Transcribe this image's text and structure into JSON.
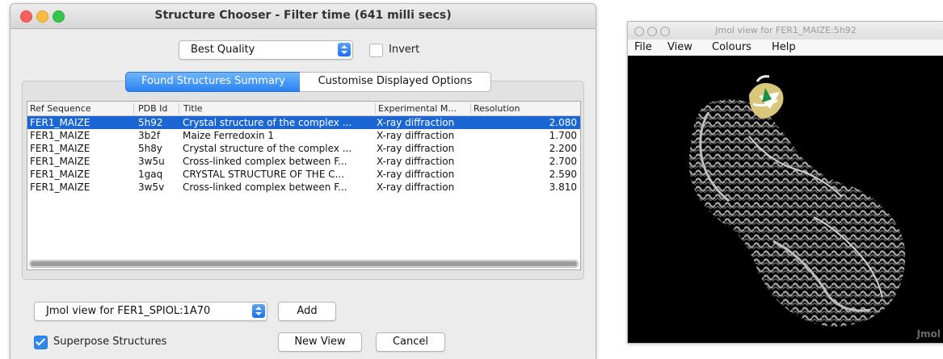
{
  "chooser_window": {
    "title": "Structure Chooser - Filter time (641 milli secs)",
    "filter_select": "Best Quality",
    "invert_label": "Invert",
    "invert_checked": false,
    "tabs": [
      {
        "label": "Found Structures Summary",
        "active": true
      },
      {
        "label": "Customise Displayed Options",
        "active": false
      }
    ],
    "table": {
      "columns": [
        "Ref Sequence",
        "PDB Id",
        "Title",
        "Experimental M...",
        "Resolution"
      ],
      "rows": [
        {
          "ref": "FER1_MAIZE",
          "pdb": "5h92",
          "title": "Crystal structure of the complex ...",
          "exp": "X-ray diffraction",
          "res": "2.080",
          "selected": true
        },
        {
          "ref": "FER1_MAIZE",
          "pdb": "3b2f",
          "title": "Maize Ferredoxin 1",
          "exp": "X-ray diffraction",
          "res": "1.700",
          "selected": false
        },
        {
          "ref": "FER1_MAIZE",
          "pdb": "5h8y",
          "title": "Crystal structure of the complex ...",
          "exp": "X-ray diffraction",
          "res": "2.200",
          "selected": false
        },
        {
          "ref": "FER1_MAIZE",
          "pdb": "3w5u",
          "title": "Cross-linked complex between F...",
          "exp": "X-ray diffraction",
          "res": "2.700",
          "selected": false
        },
        {
          "ref": "FER1_MAIZE",
          "pdb": "1gaq",
          "title": "CRYSTAL STRUCTURE OF THE C...",
          "exp": "X-ray diffraction",
          "res": "2.590",
          "selected": false
        },
        {
          "ref": "FER1_MAIZE",
          "pdb": "3w5v",
          "title": "Cross-linked complex between F...",
          "exp": "X-ray diffraction",
          "res": "3.810",
          "selected": false
        }
      ]
    },
    "viewer_select": "Jmol view for FER1_SPIOL:1A70",
    "add_label": "Add",
    "superpose_label": "Superpose Structures",
    "superpose_checked": true,
    "new_view_label": "New View",
    "cancel_label": "Cancel"
  },
  "jmol_window": {
    "title": "Jmol view for FER1_MAIZE:5h92",
    "menus": [
      "File",
      "View",
      "Colours",
      "Help"
    ],
    "logo_text": "Jmol"
  },
  "colors": {
    "selection": "#1c66d3",
    "accent": "#2f87f0",
    "canvas": "#000000",
    "protein": "#8c8c8c",
    "ligand_highlight": "#d8c77a"
  },
  "icons": [
    "close-window-icon",
    "minimize-window-icon",
    "zoom-window-icon",
    "dropdown-arrow-icon",
    "checkbox-icon",
    "protein-structure-render"
  ]
}
